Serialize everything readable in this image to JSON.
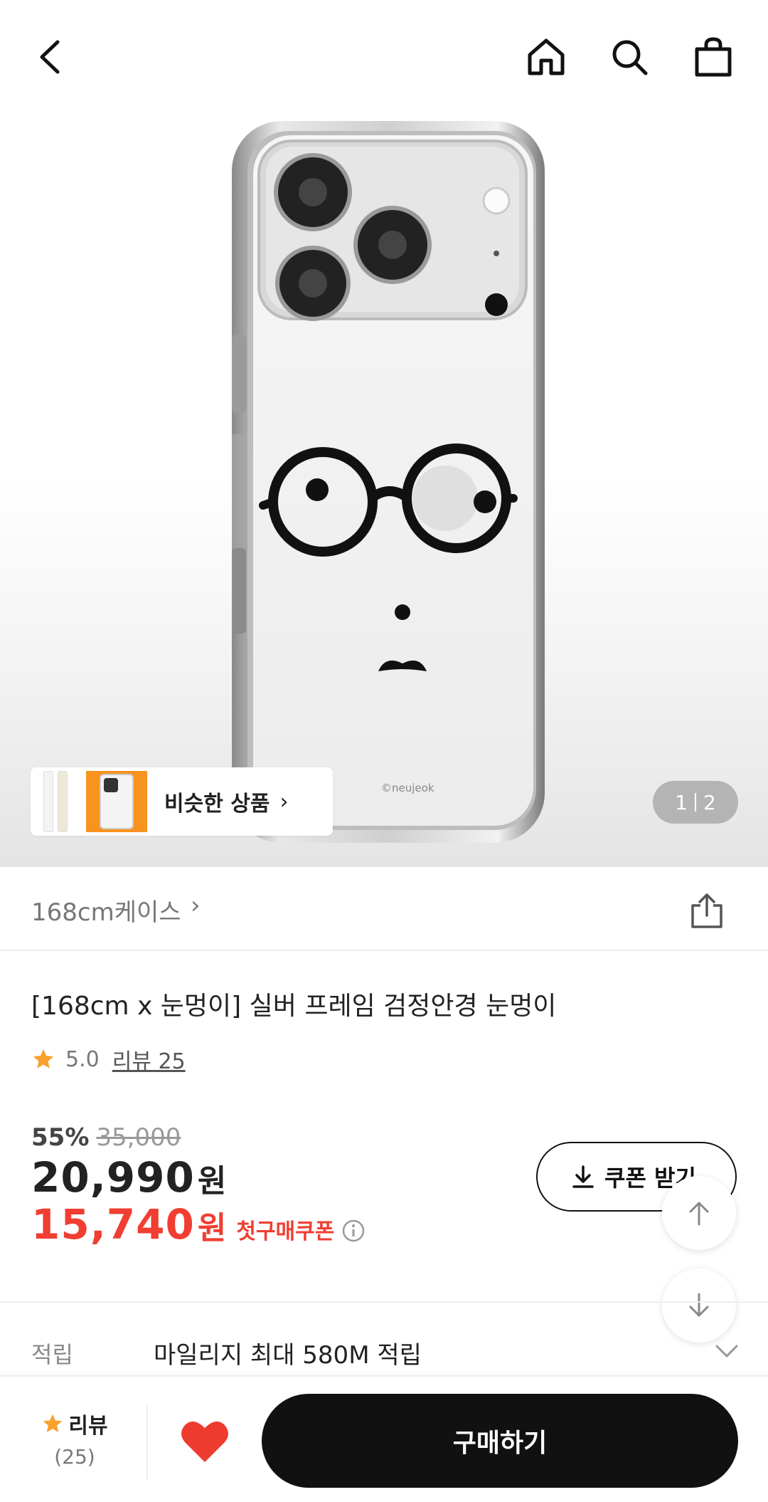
{
  "nav": {
    "back_icon": "chevron-left-icon",
    "home_icon": "home-icon",
    "search_icon": "search-icon",
    "cart_icon": "shopping-bag-icon"
  },
  "hero": {
    "phone_brand_mark": "©neujeok",
    "similar_label": "비슷한 상품",
    "page_current": "1",
    "page_total": "2"
  },
  "brand": {
    "name": "168cm케이스"
  },
  "product": {
    "title": "[168cm x 눈멍이] 실버 프레임 검정안경 눈멍이",
    "rating": "5.0",
    "review_link": "리뷰 25"
  },
  "pricing": {
    "discount_pct": "55%",
    "original_price": "35,000",
    "price": "20,990",
    "unit": "원",
    "coupon_price": "15,740",
    "coupon_label": "첫구매쿠폰",
    "coupon_button": "쿠폰 받기"
  },
  "points": {
    "label": "적립",
    "text": "마일리지 최대 580M 적립"
  },
  "bottom": {
    "review_label": "리뷰",
    "review_count": "(25)",
    "buy_label": "구매하기"
  },
  "colors": {
    "accent_red": "#f03e32",
    "star_orange": "#f7a12e",
    "heart_red": "#ee3b2f",
    "buy_button": "#111111"
  }
}
